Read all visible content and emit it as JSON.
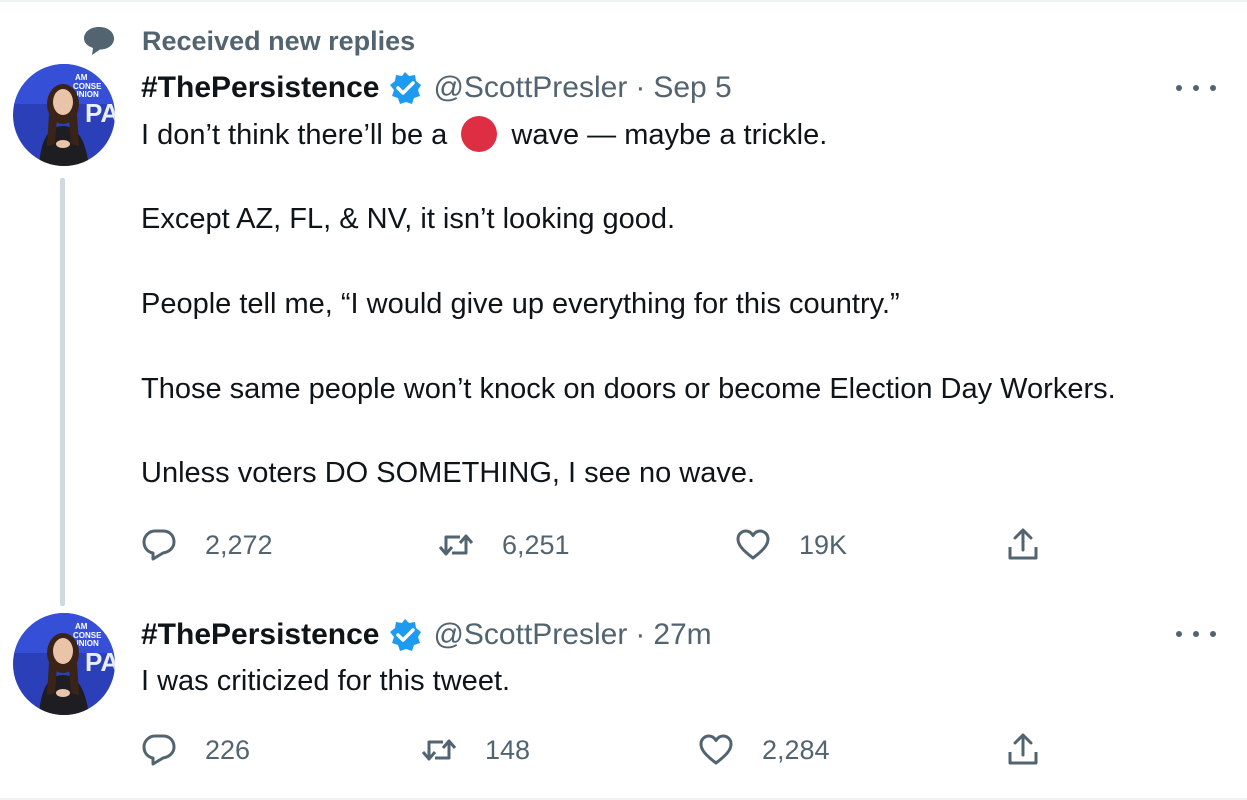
{
  "context": {
    "icon": "speech-bubble-icon",
    "label": "Received new replies"
  },
  "colors": {
    "text_primary": "#0f1419",
    "text_secondary": "#536471",
    "verified": "#1d9bf0",
    "thread_line": "#cfd9de",
    "red_circle": "#dd2e44"
  },
  "tweets": [
    {
      "display_name": "#ThePersistence",
      "handle": "@ScottPresler",
      "separator": "·",
      "time": "Sep 5",
      "text_lines": [
        {
          "before": "I don’t think there’ll be a",
          "after": "wave — maybe a trickle.",
          "emoji": "red-circle"
        },
        {
          "text": "Except AZ, FL, & NV, it isn’t looking good."
        },
        {
          "text": "People tell me, “I would give up everything for this country.”"
        },
        {
          "text": "Those same people won’t knock on doors or become Election Day Workers."
        },
        {
          "text": "Unless voters DO SOMETHING, I see no wave."
        }
      ],
      "replies": "2,272",
      "retweets": "6,251",
      "likes": "19K"
    },
    {
      "display_name": "#ThePersistence",
      "handle": "@ScottPresler",
      "separator": "·",
      "time": "27m",
      "text_lines": [
        {
          "text": "I was criticized for this tweet."
        }
      ],
      "replies": "226",
      "retweets": "148",
      "likes": "2,284"
    }
  ],
  "icons": {
    "reply": "reply-icon",
    "retweet": "retweet-icon",
    "like": "heart-icon",
    "share": "share-icon",
    "more": "more-icon",
    "verified": "verified-badge-icon"
  }
}
